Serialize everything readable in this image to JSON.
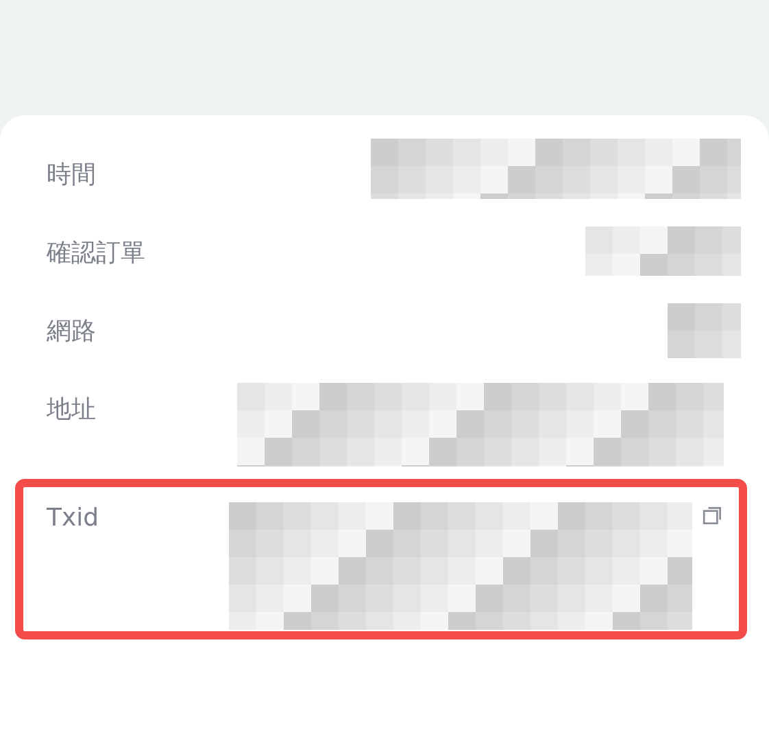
{
  "rows": [
    {
      "label": "時間",
      "redacted": true,
      "highlighted": false,
      "copyable": false
    },
    {
      "label": "確認訂單",
      "redacted": true,
      "highlighted": false,
      "copyable": false
    },
    {
      "label": "網路",
      "redacted": true,
      "highlighted": false,
      "copyable": false
    },
    {
      "label": "地址",
      "redacted": true,
      "highlighted": false,
      "copyable": false
    },
    {
      "label": "Txid",
      "redacted": true,
      "highlighted": true,
      "copyable": true
    }
  ]
}
